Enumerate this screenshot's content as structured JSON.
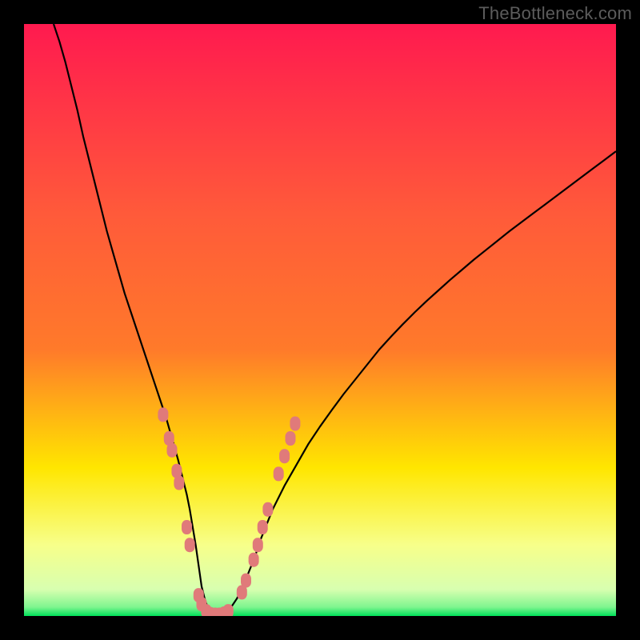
{
  "watermark": "TheBottleneck.com",
  "colors": {
    "gradient_top": "#ff1a4f",
    "gradient_mid1": "#ff7a2a",
    "gradient_mid2": "#ffe600",
    "gradient_mid3": "#f7ff8a",
    "gradient_bottom": "#00e05a",
    "curve": "#000000",
    "marker_fill": "#e07a7a",
    "marker_stroke": "#c85a5a"
  },
  "chart_data": {
    "type": "line",
    "title": "",
    "xlabel": "",
    "ylabel": "",
    "xlim": [
      0,
      100
    ],
    "ylim": [
      0,
      100
    ],
    "curve": {
      "name": "bottleneck-curve",
      "x": [
        5,
        6,
        7,
        8,
        9,
        10,
        11,
        12,
        13,
        14,
        15,
        16,
        17,
        18,
        19,
        20,
        21,
        22,
        23,
        24,
        25,
        26,
        27,
        27.5,
        28,
        28.5,
        29,
        29.5,
        30,
        30.5,
        31,
        31.5,
        32,
        33,
        34,
        35,
        36,
        37,
        38,
        39,
        40,
        42,
        44,
        46,
        48,
        50,
        52,
        54,
        56,
        58,
        60,
        62,
        64,
        66,
        68,
        70,
        72,
        74,
        76,
        78,
        80,
        82,
        84,
        86,
        88,
        90,
        92,
        94,
        96,
        98,
        100
      ],
      "y": [
        100,
        97,
        93.5,
        89.5,
        85.5,
        81,
        77,
        73,
        69,
        65,
        61.5,
        58,
        54.5,
        51.5,
        48.5,
        45.5,
        42.5,
        39.5,
        36.5,
        33.5,
        30,
        26.5,
        22.5,
        20.5,
        18,
        15,
        12,
        8.5,
        5,
        3,
        1.5,
        0.7,
        0.2,
        0.2,
        0.6,
        1.5,
        3,
        5,
        7.5,
        10,
        13,
        18,
        22,
        25.5,
        29,
        32,
        34.8,
        37.5,
        40,
        42.5,
        45,
        47.2,
        49.3,
        51.3,
        53.2,
        55,
        56.8,
        58.5,
        60.2,
        61.8,
        63.4,
        65,
        66.5,
        68,
        69.5,
        71,
        72.5,
        74,
        75.5,
        77,
        78.5
      ]
    },
    "markers": {
      "name": "data-points",
      "points": [
        {
          "x": 23.5,
          "y": 34
        },
        {
          "x": 24.5,
          "y": 30
        },
        {
          "x": 25.0,
          "y": 28
        },
        {
          "x": 25.8,
          "y": 24.5
        },
        {
          "x": 26.2,
          "y": 22.5
        },
        {
          "x": 27.5,
          "y": 15
        },
        {
          "x": 28.0,
          "y": 12
        },
        {
          "x": 29.5,
          "y": 3.5
        },
        {
          "x": 30.0,
          "y": 2
        },
        {
          "x": 30.8,
          "y": 0.8
        },
        {
          "x": 31.5,
          "y": 0.3
        },
        {
          "x": 32.3,
          "y": 0.2
        },
        {
          "x": 33.0,
          "y": 0.2
        },
        {
          "x": 33.8,
          "y": 0.4
        },
        {
          "x": 34.5,
          "y": 0.8
        },
        {
          "x": 36.8,
          "y": 4
        },
        {
          "x": 37.5,
          "y": 6
        },
        {
          "x": 38.8,
          "y": 9.5
        },
        {
          "x": 39.5,
          "y": 12
        },
        {
          "x": 40.3,
          "y": 15
        },
        {
          "x": 41.2,
          "y": 18
        },
        {
          "x": 43.0,
          "y": 24
        },
        {
          "x": 44.0,
          "y": 27
        },
        {
          "x": 45.0,
          "y": 30
        },
        {
          "x": 45.8,
          "y": 32.5
        }
      ]
    }
  }
}
